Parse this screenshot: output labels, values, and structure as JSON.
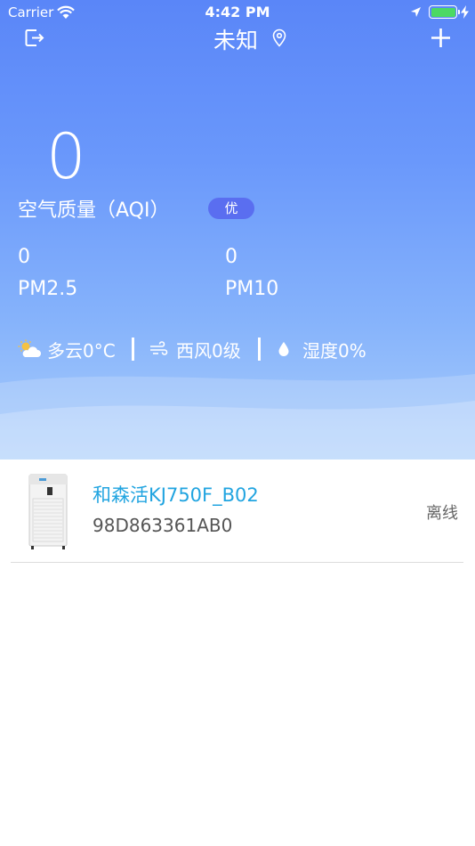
{
  "status_bar": {
    "carrier": "Carrier",
    "time": "4:42 PM"
  },
  "nav": {
    "title": "未知"
  },
  "aqi": {
    "value": "0",
    "label": "空气质量（AQI）",
    "level": "优",
    "pm25_value": "0",
    "pm25_label": "PM2.5",
    "pm10_value": "0",
    "pm10_label": "PM10"
  },
  "weather": {
    "condition": "多云0°C",
    "wind": "西风0级",
    "humidity": "湿度0%"
  },
  "devices": [
    {
      "name": "和森活KJ750F_B02",
      "mac": "98D863361AB0",
      "status": "离线"
    }
  ],
  "colors": {
    "header_top": "#5a86f8",
    "header_bottom": "#a9cdfb",
    "badge": "#5a6ef0",
    "device_name": "#21a4e0",
    "battery": "#4cd964"
  },
  "icons": {
    "logout": "logout-icon",
    "location": "location-pin-icon",
    "add": "plus-icon",
    "weather": "partly-cloudy-icon",
    "wind": "wind-icon",
    "humidity": "water-drop-icon"
  }
}
